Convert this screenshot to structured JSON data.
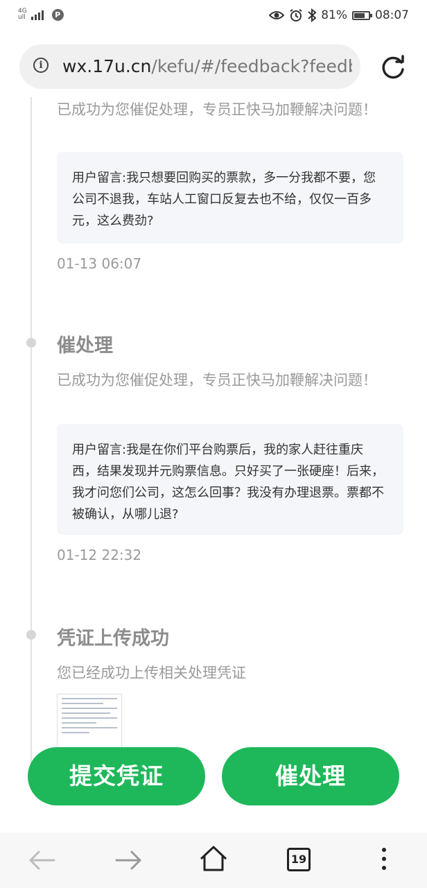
{
  "status_bar": {
    "network": "4G",
    "network_sub": "ull",
    "p_badge": "P",
    "battery": "81%",
    "time": "08:07"
  },
  "browser": {
    "url_host": "wx.17u.cn",
    "url_path": "/kefu/#/feedback?feedb",
    "tab_count": "19"
  },
  "timeline": [
    {
      "desc": "已成功为您催促处理，专员正快马加鞭解决问题！",
      "message": "用户留言:我只想要回购买的票款，多一分我都不要，您公司不退我，车站人工窗口反复去也不给，仅仅一百多元，这么费劲?",
      "time": "01-13 06:07"
    },
    {
      "title": "催处理",
      "desc": "已成功为您催促处理，专员正快马加鞭解决问题！",
      "message": "用户留言:我是在你们平台购票后，我的家人赶往重庆西，结果发现并元购票信息。只好买了一张硬座！后来，我才问您们公司，这怎么回事？我没有办理退票。票都不被确认，从哪儿退?",
      "time": "01-12 22:32"
    },
    {
      "title": "凭证上传成功",
      "desc": "您已经成功上传相关处理凭证"
    }
  ],
  "buttons": {
    "submit_proof": "提交凭证",
    "urge": "催处理"
  },
  "colors": {
    "accent": "#1eb85a",
    "message_bg": "#f4f6f9"
  }
}
